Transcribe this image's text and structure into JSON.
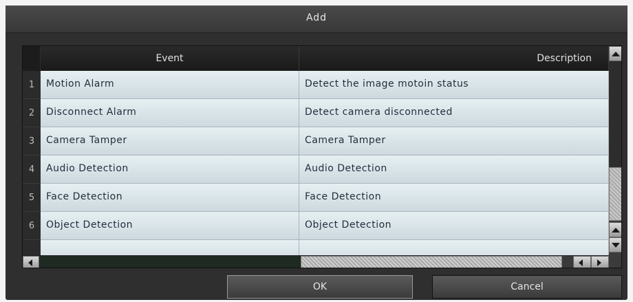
{
  "dialog": {
    "title": "Add"
  },
  "table": {
    "headers": {
      "event": "Event",
      "description": "Description"
    },
    "rows": [
      {
        "num": "1",
        "event": "Motion Alarm",
        "description": "Detect the image motoin status"
      },
      {
        "num": "2",
        "event": "Disconnect Alarm",
        "description": "Detect camera disconnected"
      },
      {
        "num": "3",
        "event": "Camera Tamper",
        "description": "Camera Tamper"
      },
      {
        "num": "4",
        "event": "Audio Detection",
        "description": "Audio Detection"
      },
      {
        "num": "5",
        "event": "Face Detection",
        "description": "Face Detection"
      },
      {
        "num": "6",
        "event": "Object Detection",
        "description": "Object Detection"
      }
    ]
  },
  "buttons": {
    "ok": "OK",
    "cancel": "Cancel"
  },
  "icons": {
    "scroll_up": "triangle-up-icon",
    "scroll_down": "triangle-down-icon",
    "scroll_left": "triangle-left-icon",
    "scroll_right": "triangle-right-icon"
  },
  "colors": {
    "dialog_bg": "#2f2f2f",
    "row_bg": "#dfe9ed",
    "text_dark": "#1f2d3b",
    "text_light": "#e6e6e6"
  }
}
